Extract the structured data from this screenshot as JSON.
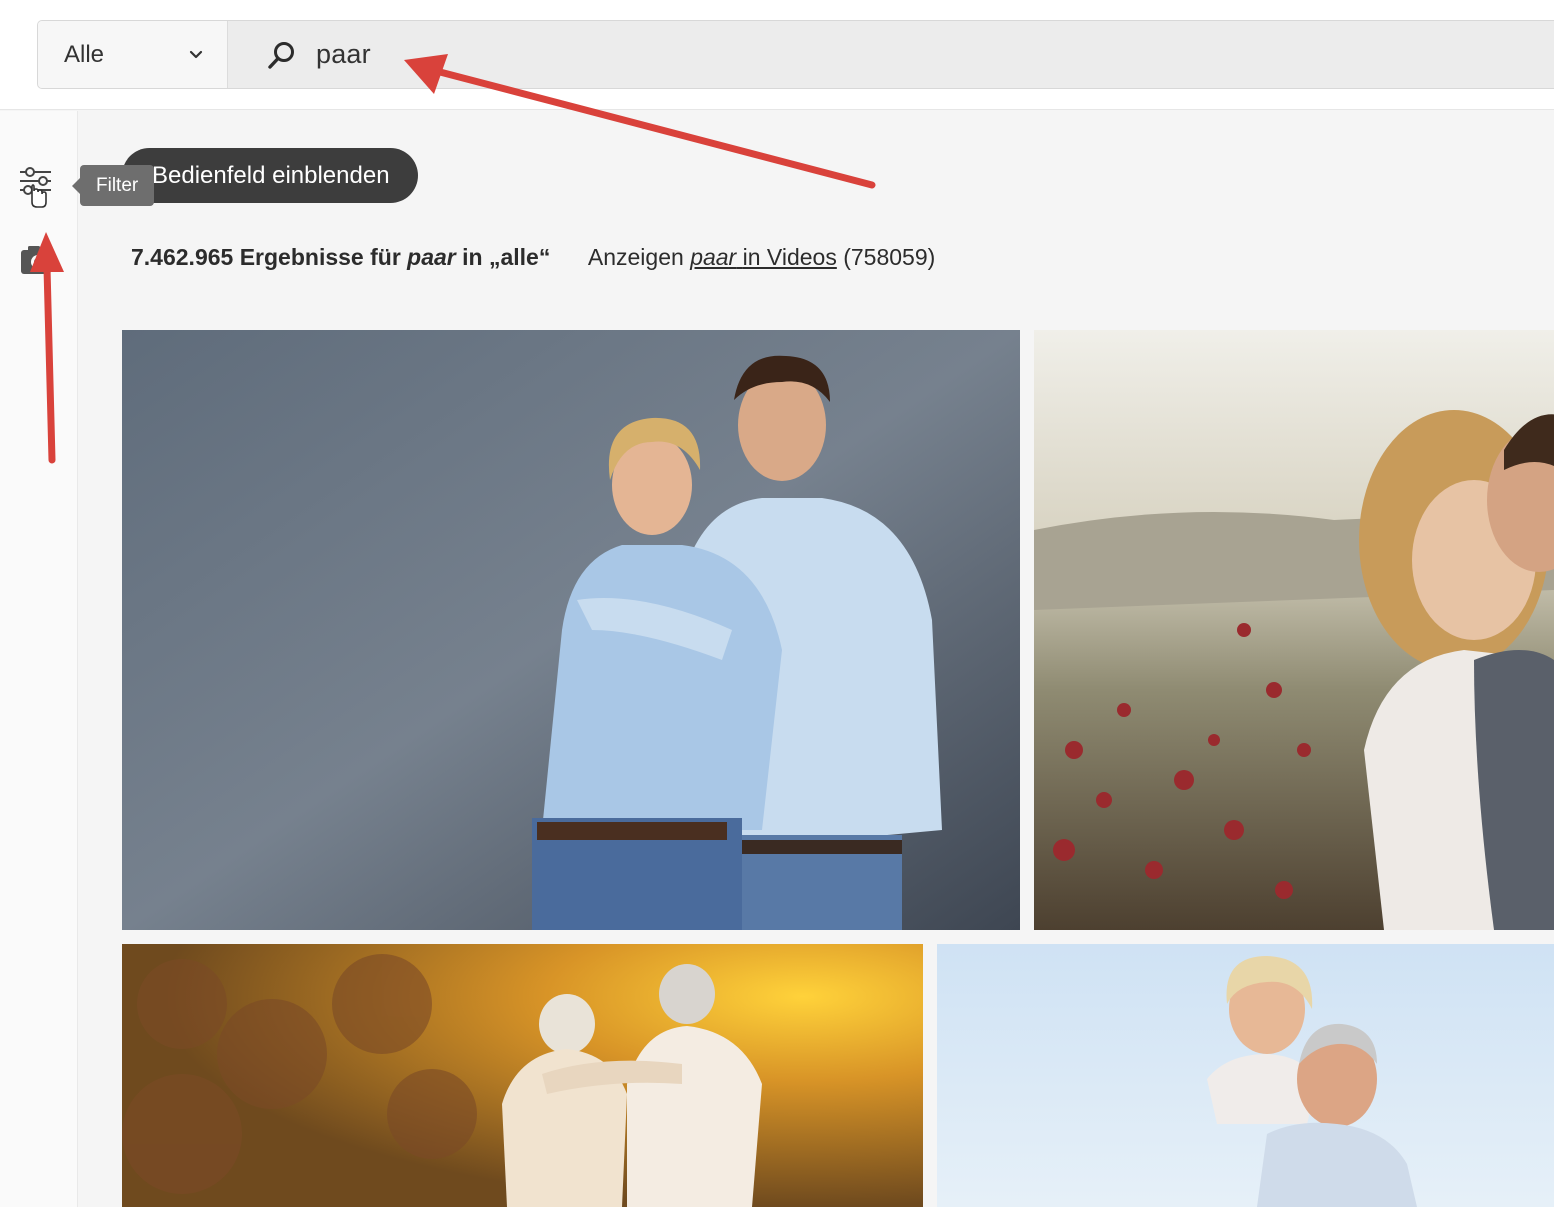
{
  "search": {
    "scope_selected": "Alle",
    "query": "paar",
    "search_icon": "search-icon",
    "chevron_icon": "chevron-down-icon"
  },
  "sidebar": {
    "items": [
      {
        "name": "filter",
        "icon": "filter-sliders-icon"
      },
      {
        "name": "visual-search",
        "icon": "camera-icon"
      }
    ],
    "tooltip": "Filter"
  },
  "panel_button": {
    "label": "Bedienfeld einblenden"
  },
  "results": {
    "count": "7.462.965",
    "text_ergebnisse": "Ergebnisse für",
    "query": "paar",
    "text_in": "in",
    "scope": "„alle“",
    "show_prefix": "Anzeigen",
    "video_query": "paar",
    "video_link": "in Videos",
    "video_count": "(758059)"
  },
  "colors": {
    "accent_arrow": "#d9423b",
    "pill_bg": "#3d3d3d",
    "tooltip_bg": "#6e6e6e"
  }
}
